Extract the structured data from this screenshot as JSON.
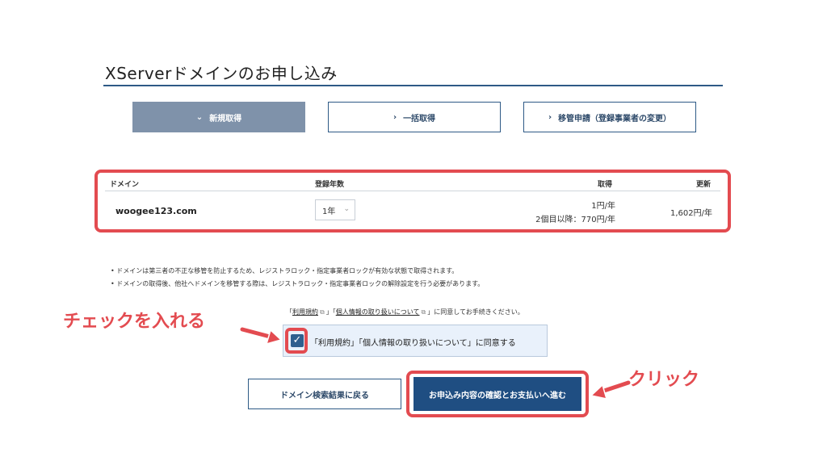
{
  "header": {
    "title": "XServerドメインのお申し込み"
  },
  "tabs": [
    {
      "label": "新規取得",
      "chevron": "⌄",
      "active": true
    },
    {
      "label": "一括取得",
      "chevron": "›",
      "active": false
    },
    {
      "label": "移管申請（登録事業者の変更）",
      "chevron": "›",
      "active": false
    }
  ],
  "table": {
    "headers": {
      "domain": "ドメイン",
      "years": "登録年数",
      "acquire": "取得",
      "renew": "更新"
    },
    "row": {
      "domain": "woogee123.com",
      "years_value": "1年",
      "acquire_price": "1円/年",
      "acquire_price_second": "2個目以降：770円/年",
      "renew_price": "1,602円/年"
    }
  },
  "notes": [
    "ドメインは第三者の不正な移管を防止するため、レジストラロック・指定事業者ロックが有効な状態で取得されます。",
    "ドメインの取得後、他社へドメインを移管する際は、レジストラロック・指定事業者ロックの解除設定を行う必要があります。"
  ],
  "agreement": {
    "links_prefix": "「",
    "terms_link": "利用規約",
    "mid": "」「",
    "privacy_link": "個人情報の取り扱いについて",
    "links_suffix": "」に同意してお手続きください。",
    "checkbox_label": "「利用規約」「個人情報の取り扱いについて」に同意する",
    "checked": true
  },
  "buttons": {
    "back_label": "ドメイン検索結果に戻る",
    "next_label": "お申込み内容の確認とお支払いへ進む"
  },
  "annotations": {
    "check_text": "チェックを入れる",
    "click_text": "クリック",
    "color": "#e34b50"
  },
  "colors": {
    "accent": "#2e5a86",
    "primary_button": "#1f4e82",
    "active_tab": "#7f92aa"
  }
}
